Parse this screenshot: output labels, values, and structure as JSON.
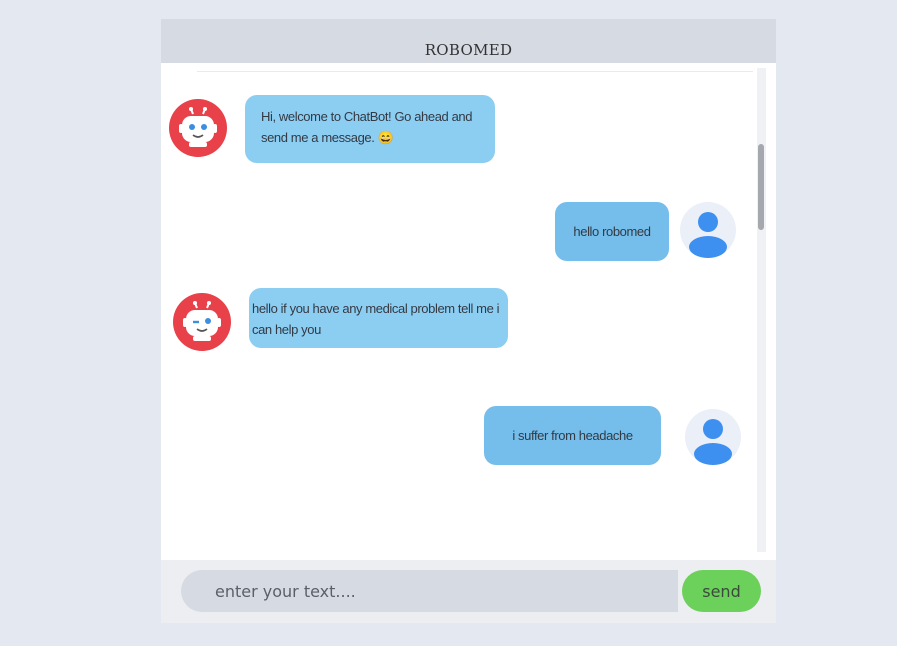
{
  "header": {
    "title": "ROBOMED"
  },
  "messages": [
    {
      "sender": "bot",
      "text": "Hi, welcome to ChatBot! Go ahead and send me a message. 😄"
    },
    {
      "sender": "user",
      "text": "hello robomed"
    },
    {
      "sender": "bot",
      "text": "hello if you have any medical problem tell me i can help you"
    },
    {
      "sender": "user",
      "text": "i suffer from headache"
    }
  ],
  "input": {
    "placeholder": "enter your text....",
    "value": ""
  },
  "send_button": {
    "label": "send"
  },
  "colors": {
    "page_background": "#e4e8f0",
    "header_background": "#d6dae3",
    "bot_bubble": "#8ccdf2",
    "user_bubble": "#75bdea",
    "bot_avatar": "#e8414a",
    "user_avatar_icon": "#3d8ff0",
    "send_button": "#6cd15b"
  },
  "icons": {
    "bot_avatar": "robot-face-icon",
    "user_avatar": "user-silhouette-icon"
  }
}
